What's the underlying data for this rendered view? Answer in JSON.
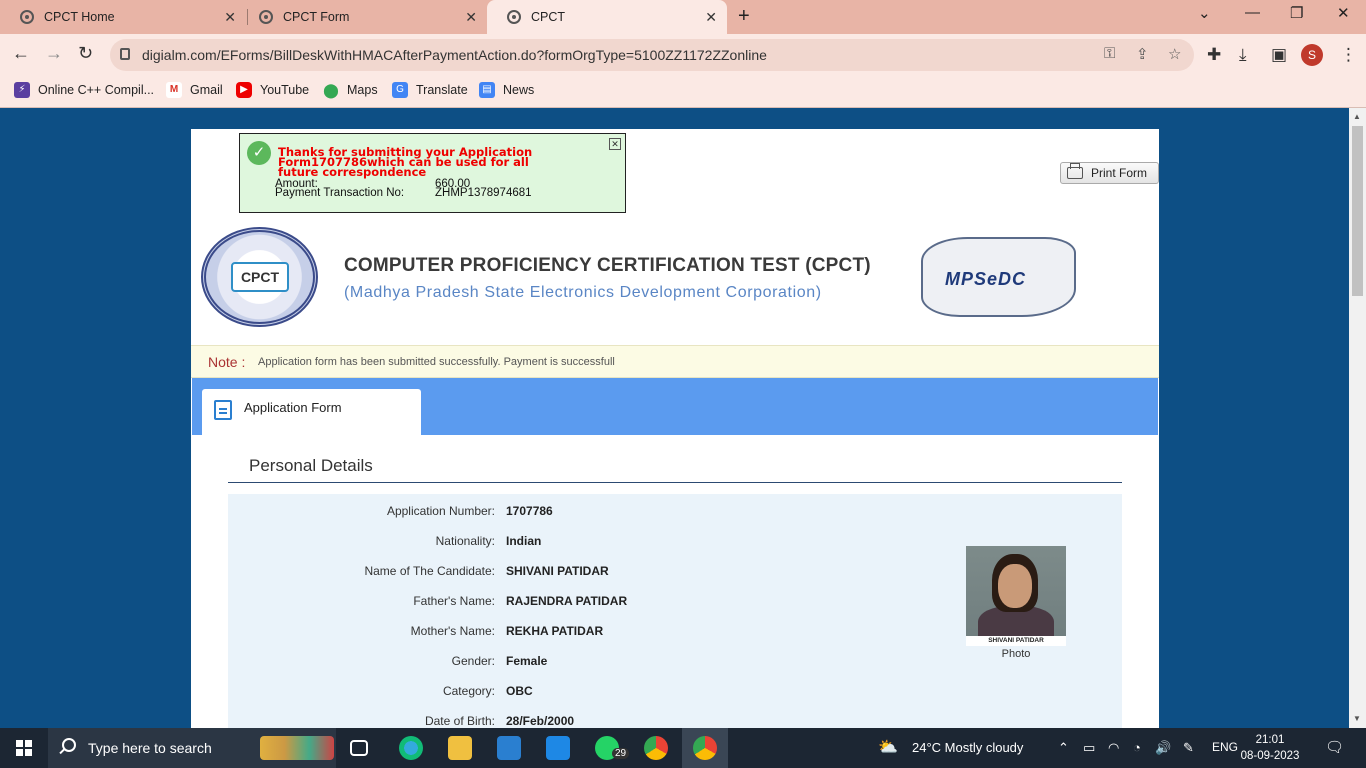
{
  "browser": {
    "tabs": [
      {
        "label": "CPCT Home"
      },
      {
        "label": "CPCT Form"
      },
      {
        "label": "CPCT"
      }
    ],
    "url": "digialm.com/EForms/BillDeskWithHMACAfterPaymentAction.do?formOrgType=5100ZZ1172ZZonline",
    "profile_initial": "S",
    "bookmarks": [
      {
        "label": "Online C++ Compil..."
      },
      {
        "label": "Gmail"
      },
      {
        "label": "YouTube"
      },
      {
        "label": "Maps"
      },
      {
        "label": "Translate"
      },
      {
        "label": "News"
      }
    ]
  },
  "notice": {
    "message": "Thanks for submitting your Application Form1707786which can be used for all future correspondence",
    "amount_label": "Amount:",
    "amount_value": "660.00",
    "txn_label": "Payment Transaction No:",
    "txn_value": "ZHMP1378974681"
  },
  "print_button": "Print Form",
  "header": {
    "seal_text": "CPCT",
    "title": "COMPUTER PROFICIENCY CERTIFICATION TEST (CPCT)",
    "subtitle": "(Madhya Pradesh State Electronics Development Corporation)",
    "logo_text": "MPSeDC"
  },
  "note": {
    "label": "Note :",
    "text": "Application form has been submitted successfully. Payment is successfull"
  },
  "form_tab": "Application Form",
  "section_title": "Personal Details",
  "details": [
    {
      "label": "Application Number:",
      "value": "1707786"
    },
    {
      "label": "Nationality:",
      "value": "Indian"
    },
    {
      "label": "Name of The Candidate:",
      "value": "SHIVANI PATIDAR"
    },
    {
      "label": "Father's Name:",
      "value": "RAJENDRA PATIDAR"
    },
    {
      "label": "Mother's Name:",
      "value": "REKHA PATIDAR"
    },
    {
      "label": "Gender:",
      "value": "Female"
    },
    {
      "label": "Category:",
      "value": "OBC"
    },
    {
      "label": "Date of Birth:",
      "value": "28/Feb/2000"
    }
  ],
  "photo": {
    "name_strip": "SHIVANI PATIDAR",
    "caption": "Photo"
  },
  "taskbar": {
    "search_placeholder": "Type here to search",
    "whatsapp_badge": "29",
    "weather": "24°C  Mostly cloudy",
    "language": "ENG",
    "time": "21:01",
    "date": "08-09-2023"
  }
}
